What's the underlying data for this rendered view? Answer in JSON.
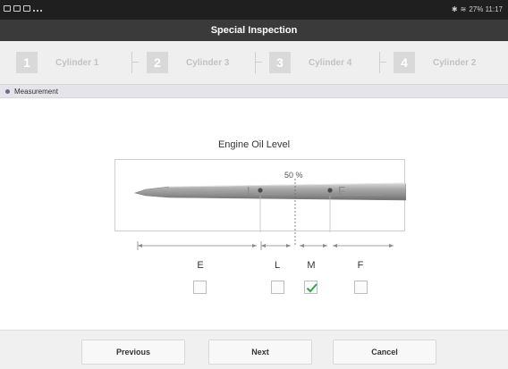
{
  "status_bar": {
    "right_text": "27% 11:17"
  },
  "header": {
    "title": "Special Inspection"
  },
  "steps": [
    {
      "number": "1",
      "label": "Cylinder 1"
    },
    {
      "number": "2",
      "label": "Cylinder 3"
    },
    {
      "number": "3",
      "label": "Cylinder 4"
    },
    {
      "number": "4",
      "label": "Cylinder 2"
    }
  ],
  "section": {
    "label": "Measurement"
  },
  "gauge": {
    "title": "Engine Oil Level",
    "percent_label": "50 %",
    "level_fraction": 0.5,
    "dipstick_marks": [
      "L",
      "F"
    ]
  },
  "options": [
    {
      "label": "E",
      "checked": false
    },
    {
      "label": "L",
      "checked": false
    },
    {
      "label": "M",
      "checked": true
    },
    {
      "label": "F",
      "checked": false
    }
  ],
  "footer": {
    "previous_label": "Previous",
    "next_label": "Next",
    "cancel_label": "Cancel"
  },
  "colors": {
    "status_bar": "#1f1f1f",
    "title_bar": "#3a3a3a",
    "check_green": "#3aa24a"
  }
}
